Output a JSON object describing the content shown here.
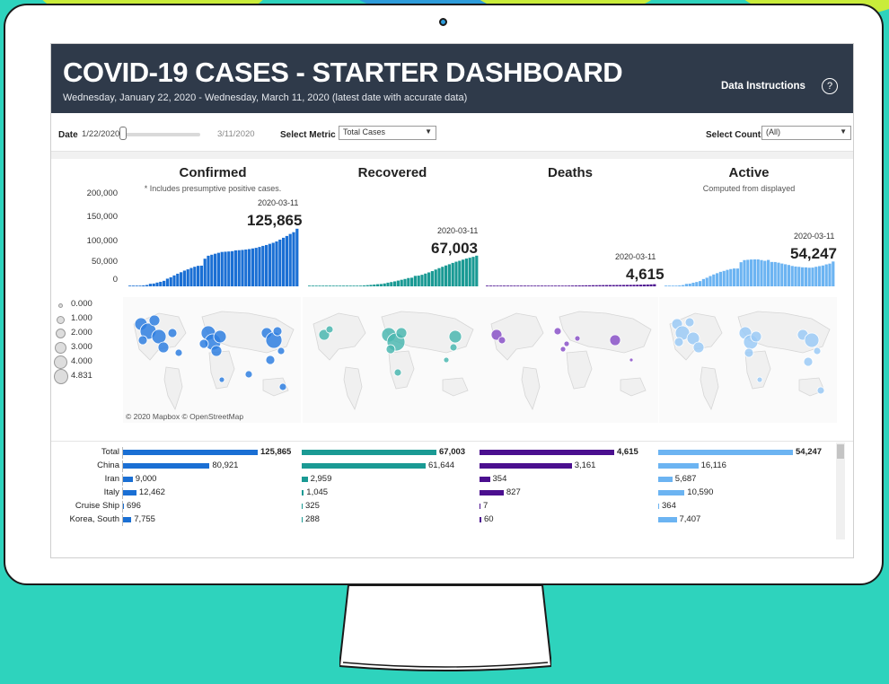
{
  "header": {
    "title": "COVID-19 CASES - STARTER DASHBOARD",
    "subtitle": "Wednesday, January 22, 2020 - Wednesday, March 11, 2020 (latest date with accurate data)",
    "data_instructions": "Data Instructions",
    "help_glyph": "?"
  },
  "controls": {
    "date_label": "Date",
    "date_start": "1/22/2020",
    "date_end": "3/11/2020",
    "date_slider_position": 0,
    "metric_label": "Select Metric",
    "metric_value": "Total Cases",
    "country_label": "Select Country",
    "country_value": "(All)"
  },
  "colors": {
    "confirmed": "#1a6fd4",
    "recovered": "#1a9a94",
    "deaths": "#4b0f8f",
    "active": "#6cb4f2",
    "header_bg": "#2f3a4a"
  },
  "y_ticks": [
    "200,000",
    "150,000",
    "100,000",
    "50,000",
    "0"
  ],
  "panels": [
    {
      "key": "confirmed",
      "title": "Confirmed",
      "note": "* Includes presumptive positive cases.",
      "date": "2020-03-11",
      "value": "125,865"
    },
    {
      "key": "recovered",
      "title": "Recovered",
      "note": "",
      "date": "2020-03-11",
      "value": "67,003"
    },
    {
      "key": "deaths",
      "title": "Deaths",
      "note": "",
      "date": "2020-03-11",
      "value": "4,615"
    },
    {
      "key": "active",
      "title": "Active",
      "note": "Computed from displayed",
      "date": "2020-03-11",
      "value": "54,247"
    }
  ],
  "chart_data": [
    {
      "type": "bar",
      "name": "Confirmed",
      "ylim": [
        0,
        200000
      ],
      "values": [
        555,
        654,
        941,
        1434,
        2118,
        2927,
        5578,
        6166,
        8234,
        9927,
        12038,
        16787,
        19881,
        23892,
        27636,
        30818,
        34392,
        37121,
        40151,
        42763,
        44803,
        45222,
        60370,
        66887,
        69032,
        71226,
        73260,
        75138,
        75641,
        76199,
        76843,
        78599,
        78985,
        79570,
        80415,
        81397,
        82756,
        84124,
        86013,
        88371,
        90309,
        92844,
        95124,
        98124,
        102050,
        106099,
        109991,
        114442,
        118326,
        125865
      ]
    },
    {
      "type": "bar",
      "name": "Recovered",
      "ylim": [
        0,
        200000
      ],
      "values": [
        28,
        30,
        36,
        39,
        52,
        61,
        107,
        126,
        143,
        222,
        284,
        472,
        623,
        852,
        1124,
        1487,
        2011,
        2616,
        3244,
        3946,
        4683,
        5150,
        6295,
        8058,
        9395,
        10865,
        12583,
        14352,
        16121,
        18177,
        18890,
        22886,
        23394,
        25227,
        27905,
        30384,
        33277,
        36711,
        39782,
        42716,
        45602,
        48228,
        51170,
        53796,
        55865,
        58358,
        60694,
        62494,
        64404,
        67003
      ]
    },
    {
      "type": "bar",
      "name": "Deaths",
      "ylim": [
        0,
        200000
      ],
      "values": [
        17,
        18,
        26,
        42,
        56,
        82,
        131,
        133,
        171,
        213,
        259,
        362,
        426,
        492,
        564,
        634,
        719,
        806,
        906,
        1013,
        1113,
        1118,
        1371,
        1523,
        1666,
        1770,
        1868,
        2007,
        2122,
        2247,
        2251,
        2458,
        2469,
        2629,
        2708,
        2770,
        2814,
        2872,
        2941,
        2996,
        3085,
        3160,
        3254,
        3348,
        3460,
        3558,
        3803,
        3996,
        4262,
        4615
      ]
    },
    {
      "type": "bar",
      "name": "Active",
      "ylim": [
        0,
        200000
      ],
      "values": [
        510,
        606,
        879,
        1353,
        2010,
        2784,
        5340,
        5907,
        7920,
        9492,
        11495,
        15953,
        18832,
        22548,
        25948,
        28697,
        31662,
        33699,
        36001,
        37804,
        39007,
        38954,
        52704,
        57306,
        57971,
        58591,
        58809,
        58779,
        57398,
        55775,
        57702,
        53255,
        53122,
        51714,
        49802,
        48243,
        46665,
        44541,
        43290,
        42659,
        41622,
        41456,
        40700,
        40980,
        42725,
        44183,
        45494,
        47952,
        49660,
        54247
      ]
    }
  ],
  "map_legend": [
    "0.000",
    "1.000",
    "2.000",
    "3.000",
    "4.000",
    "4.831"
  ],
  "map_attribution": "© 2020 Mapbox © OpenStreetMap",
  "table": {
    "rows": [
      {
        "label": "Total",
        "values": [
          "125,865",
          "67,003",
          "4,615",
          "54,247"
        ],
        "nums": [
          125865,
          67003,
          4615,
          54247
        ],
        "bold": true
      },
      {
        "label": "China",
        "values": [
          "80,921",
          "61,644",
          "3,161",
          "16,116"
        ],
        "nums": [
          80921,
          61644,
          3161,
          16116
        ],
        "bold": false
      },
      {
        "label": "Iran",
        "values": [
          "9,000",
          "2,959",
          "354",
          "5,687"
        ],
        "nums": [
          9000,
          2959,
          354,
          5687
        ],
        "bold": false
      },
      {
        "label": "Italy",
        "values": [
          "12,462",
          "1,045",
          "827",
          "10,590"
        ],
        "nums": [
          12462,
          1045,
          827,
          10590
        ],
        "bold": false
      },
      {
        "label": "Cruise Ship",
        "values": [
          "696",
          "325",
          "7",
          "364"
        ],
        "nums": [
          696,
          325,
          7,
          364
        ],
        "bold": false
      },
      {
        "label": "Korea, South",
        "values": [
          "7,755",
          "288",
          "60",
          "7,407"
        ],
        "nums": [
          7755,
          288,
          60,
          7407
        ],
        "bold": false
      }
    ],
    "column_max": [
      125865,
      67003,
      4615,
      54247
    ]
  }
}
